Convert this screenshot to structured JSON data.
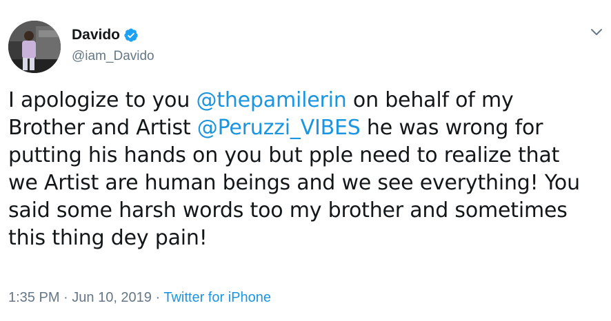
{
  "author": {
    "display_name": "Davido",
    "handle": "@iam_Davido",
    "verified": true
  },
  "icons": {
    "verified": "verified-badge-icon",
    "menu": "chevron-down-icon"
  },
  "tweet": {
    "lines": [
      [
        {
          "text": "I apologize to you ",
          "type": "text"
        },
        {
          "text": "@thepamilerin",
          "type": "mention"
        },
        {
          "text": " on behalf of my",
          "type": "text"
        }
      ],
      [
        {
          "text": "Brother and Artist ",
          "type": "text"
        },
        {
          "text": "@Peruzzi_VIBES",
          "type": "mention"
        },
        {
          "text": " he was wrong for",
          "type": "text"
        }
      ],
      [
        {
          "text": "putting his hands on you but pple need to realize that",
          "type": "text"
        }
      ],
      [
        {
          "text": "we Artist are human beings and we see everything! You",
          "type": "text"
        }
      ],
      [
        {
          "text": "said some harsh words too my brother and sometimes",
          "type": "text"
        }
      ],
      [
        {
          "text": "this thing dey pain!",
          "type": "text"
        }
      ]
    ]
  },
  "meta": {
    "time": "1:35 PM",
    "separator": " · ",
    "date": "Jun 10, 2019",
    "source": "Twitter for iPhone"
  },
  "colors": {
    "text": "#14171a",
    "secondary": "#657786",
    "link": "#1b95e0",
    "verified": "#1da1f2"
  }
}
